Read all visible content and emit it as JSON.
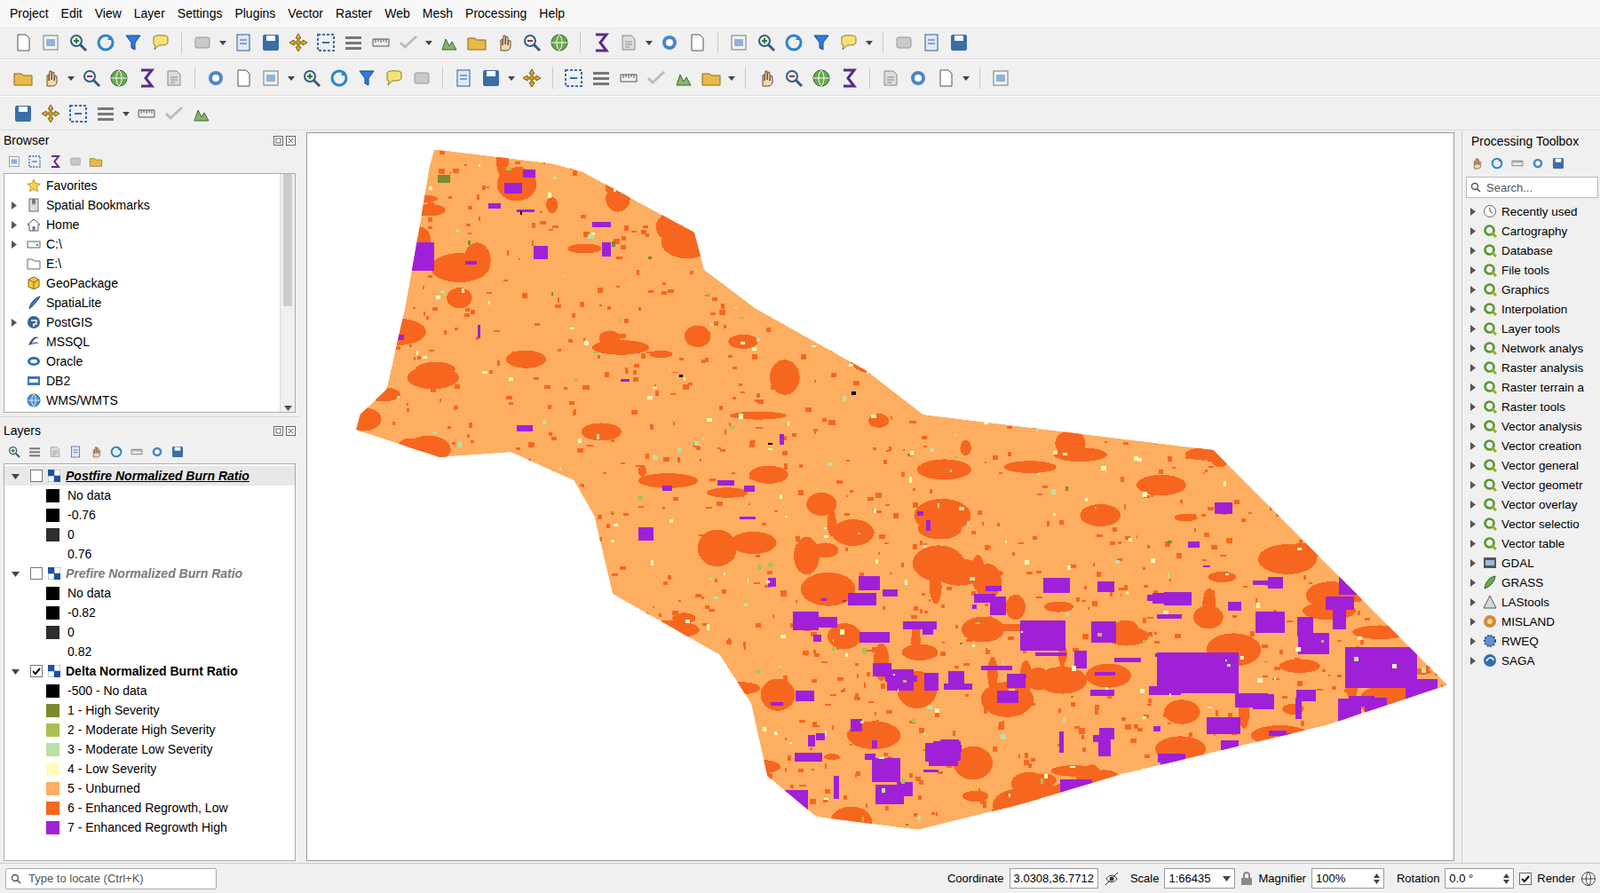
{
  "menu": [
    "Project",
    "Edit",
    "View",
    "Layer",
    "Settings",
    "Plugins",
    "Vector",
    "Raster",
    "Web",
    "Mesh",
    "Processing",
    "Help"
  ],
  "browser": {
    "title": "Browser",
    "items": [
      {
        "label": "Favorites",
        "kind": "favorites",
        "expandable": false
      },
      {
        "label": "Spatial Bookmarks",
        "kind": "bookmarks",
        "expandable": true
      },
      {
        "label": "Home",
        "kind": "home",
        "expandable": true
      },
      {
        "label": "C:\\",
        "kind": "drive",
        "expandable": true
      },
      {
        "label": "E:\\",
        "kind": "folder",
        "expandable": false
      },
      {
        "label": "GeoPackage",
        "kind": "geopackage",
        "expandable": false
      },
      {
        "label": "SpatiaLite",
        "kind": "spatialite",
        "expandable": false
      },
      {
        "label": "PostGIS",
        "kind": "postgis",
        "expandable": true
      },
      {
        "label": "MSSQL",
        "kind": "mssql",
        "expandable": false
      },
      {
        "label": "Oracle",
        "kind": "oracle",
        "expandable": false
      },
      {
        "label": "DB2",
        "kind": "db2",
        "expandable": false
      },
      {
        "label": "WMS/WMTS",
        "kind": "wms",
        "expandable": false
      }
    ]
  },
  "layers": {
    "title": "Layers",
    "groups": [
      {
        "name": "Postfire Normalized Burn Ratio",
        "visible": false,
        "expanded": true,
        "current": true,
        "greyed": false,
        "legend": [
          {
            "label": "No data",
            "color": "#000000"
          },
          {
            "label": "-0.76",
            "color": "#000000"
          },
          {
            "label": "0",
            "color": "#2e2e2e"
          },
          {
            "label": "0.76",
            "color": "#ffffff"
          }
        ]
      },
      {
        "name": "Prefire Normalized Burn Ratio",
        "visible": false,
        "expanded": true,
        "current": false,
        "greyed": true,
        "legend": [
          {
            "label": "No data",
            "color": "#000000"
          },
          {
            "label": "-0.82",
            "color": "#000000"
          },
          {
            "label": "0",
            "color": "#2e2e2e"
          },
          {
            "label": "0.82",
            "color": "#ffffff"
          }
        ]
      },
      {
        "name": "Delta Normalized Burnt Ratio",
        "visible": true,
        "expanded": true,
        "current": false,
        "greyed": false,
        "legend": [
          {
            "label": "-500 - No data",
            "color": "#000000"
          },
          {
            "label": "1 - High Severity",
            "color": "#7a8a2c"
          },
          {
            "label": "2 - Moderate High Severity",
            "color": "#a8c252"
          },
          {
            "label": "3 - Moderate Low Severity",
            "color": "#b9e1a4"
          },
          {
            "label": "4 - Low Severity",
            "color": "#fffcbc"
          },
          {
            "label": "5 - Unburned",
            "color": "#fdae61"
          },
          {
            "label": "6 - Enhanced Regrowth, Low",
            "color": "#f7661e"
          },
          {
            "label": "7 - Enhanced Regrowth High",
            "color": "#a020d8"
          }
        ]
      }
    ]
  },
  "processing": {
    "title": "Processing Toolbox",
    "search": {
      "placeholder": "Search..."
    },
    "items": [
      {
        "label": "Recently used",
        "kind": "recent",
        "expanded": false
      },
      {
        "label": "Cartography",
        "kind": "qgis",
        "expanded": false
      },
      {
        "label": "Database",
        "kind": "qgis",
        "expanded": false
      },
      {
        "label": "File tools",
        "kind": "qgis",
        "expanded": false
      },
      {
        "label": "Graphics",
        "kind": "qgis",
        "expanded": false
      },
      {
        "label": "Interpolation",
        "kind": "qgis",
        "expanded": false
      },
      {
        "label": "Layer tools",
        "kind": "qgis",
        "expanded": false
      },
      {
        "label": "Network analys",
        "kind": "qgis",
        "expanded": false
      },
      {
        "label": "Raster analysis",
        "kind": "qgis",
        "expanded": false
      },
      {
        "label": "Raster terrain a",
        "kind": "qgis",
        "expanded": false
      },
      {
        "label": "Raster tools",
        "kind": "qgis",
        "expanded": false
      },
      {
        "label": "Vector analysis",
        "kind": "qgis",
        "expanded": false
      },
      {
        "label": "Vector creation",
        "kind": "qgis",
        "expanded": false
      },
      {
        "label": "Vector general",
        "kind": "qgis",
        "expanded": false
      },
      {
        "label": "Vector geometr",
        "kind": "qgis",
        "expanded": false
      },
      {
        "label": "Vector overlay",
        "kind": "qgis",
        "expanded": false
      },
      {
        "label": "Vector selectio",
        "kind": "qgis",
        "expanded": false
      },
      {
        "label": "Vector table",
        "kind": "qgis",
        "expanded": false
      },
      {
        "label": "GDAL",
        "kind": "gdal",
        "expanded": false
      },
      {
        "label": "GRASS",
        "kind": "grass",
        "expanded": false
      },
      {
        "label": "LAStools",
        "kind": "lastools",
        "expanded": false
      },
      {
        "label": "MISLAND",
        "kind": "misland",
        "expanded": false
      },
      {
        "label": "RWEQ",
        "kind": "rweq",
        "expanded": false
      },
      {
        "label": "SAGA",
        "kind": "saga",
        "expanded": false
      }
    ]
  },
  "status_bar": {
    "locate": {
      "placeholder": "Type to locate (Ctrl+K)"
    },
    "coordinate_label": "Coordinate",
    "coordinate": "3.0308,36.7712",
    "scale_label": "Scale",
    "scale": "1:66435",
    "magnifier_label": "Magnifier",
    "magnifier": "100%",
    "rotation_label": "Rotation",
    "rotation": "0.0 °",
    "render_label": "Render",
    "render": true
  }
}
